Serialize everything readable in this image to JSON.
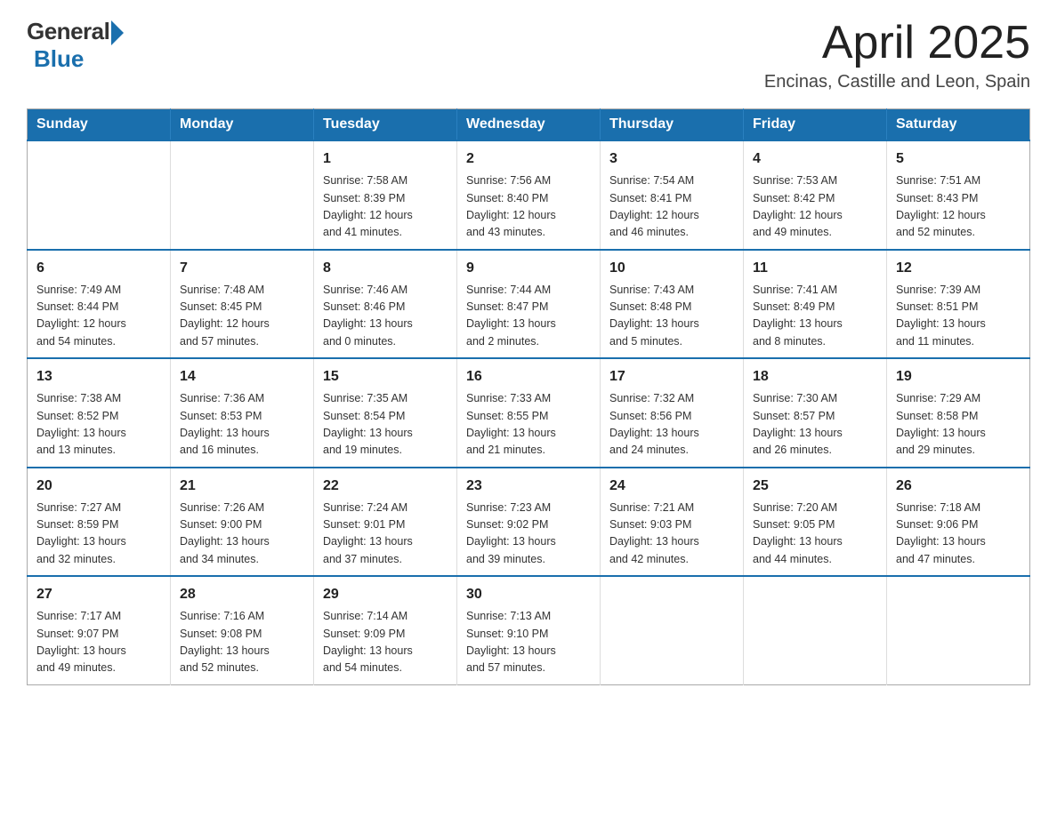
{
  "header": {
    "logo_general": "General",
    "logo_blue": "Blue",
    "month_title": "April 2025",
    "location": "Encinas, Castille and Leon, Spain"
  },
  "weekdays": [
    "Sunday",
    "Monday",
    "Tuesday",
    "Wednesday",
    "Thursday",
    "Friday",
    "Saturday"
  ],
  "weeks": [
    [
      {
        "day": "",
        "info": ""
      },
      {
        "day": "",
        "info": ""
      },
      {
        "day": "1",
        "info": "Sunrise: 7:58 AM\nSunset: 8:39 PM\nDaylight: 12 hours\nand 41 minutes."
      },
      {
        "day": "2",
        "info": "Sunrise: 7:56 AM\nSunset: 8:40 PM\nDaylight: 12 hours\nand 43 minutes."
      },
      {
        "day": "3",
        "info": "Sunrise: 7:54 AM\nSunset: 8:41 PM\nDaylight: 12 hours\nand 46 minutes."
      },
      {
        "day": "4",
        "info": "Sunrise: 7:53 AM\nSunset: 8:42 PM\nDaylight: 12 hours\nand 49 minutes."
      },
      {
        "day": "5",
        "info": "Sunrise: 7:51 AM\nSunset: 8:43 PM\nDaylight: 12 hours\nand 52 minutes."
      }
    ],
    [
      {
        "day": "6",
        "info": "Sunrise: 7:49 AM\nSunset: 8:44 PM\nDaylight: 12 hours\nand 54 minutes."
      },
      {
        "day": "7",
        "info": "Sunrise: 7:48 AM\nSunset: 8:45 PM\nDaylight: 12 hours\nand 57 minutes."
      },
      {
        "day": "8",
        "info": "Sunrise: 7:46 AM\nSunset: 8:46 PM\nDaylight: 13 hours\nand 0 minutes."
      },
      {
        "day": "9",
        "info": "Sunrise: 7:44 AM\nSunset: 8:47 PM\nDaylight: 13 hours\nand 2 minutes."
      },
      {
        "day": "10",
        "info": "Sunrise: 7:43 AM\nSunset: 8:48 PM\nDaylight: 13 hours\nand 5 minutes."
      },
      {
        "day": "11",
        "info": "Sunrise: 7:41 AM\nSunset: 8:49 PM\nDaylight: 13 hours\nand 8 minutes."
      },
      {
        "day": "12",
        "info": "Sunrise: 7:39 AM\nSunset: 8:51 PM\nDaylight: 13 hours\nand 11 minutes."
      }
    ],
    [
      {
        "day": "13",
        "info": "Sunrise: 7:38 AM\nSunset: 8:52 PM\nDaylight: 13 hours\nand 13 minutes."
      },
      {
        "day": "14",
        "info": "Sunrise: 7:36 AM\nSunset: 8:53 PM\nDaylight: 13 hours\nand 16 minutes."
      },
      {
        "day": "15",
        "info": "Sunrise: 7:35 AM\nSunset: 8:54 PM\nDaylight: 13 hours\nand 19 minutes."
      },
      {
        "day": "16",
        "info": "Sunrise: 7:33 AM\nSunset: 8:55 PM\nDaylight: 13 hours\nand 21 minutes."
      },
      {
        "day": "17",
        "info": "Sunrise: 7:32 AM\nSunset: 8:56 PM\nDaylight: 13 hours\nand 24 minutes."
      },
      {
        "day": "18",
        "info": "Sunrise: 7:30 AM\nSunset: 8:57 PM\nDaylight: 13 hours\nand 26 minutes."
      },
      {
        "day": "19",
        "info": "Sunrise: 7:29 AM\nSunset: 8:58 PM\nDaylight: 13 hours\nand 29 minutes."
      }
    ],
    [
      {
        "day": "20",
        "info": "Sunrise: 7:27 AM\nSunset: 8:59 PM\nDaylight: 13 hours\nand 32 minutes."
      },
      {
        "day": "21",
        "info": "Sunrise: 7:26 AM\nSunset: 9:00 PM\nDaylight: 13 hours\nand 34 minutes."
      },
      {
        "day": "22",
        "info": "Sunrise: 7:24 AM\nSunset: 9:01 PM\nDaylight: 13 hours\nand 37 minutes."
      },
      {
        "day": "23",
        "info": "Sunrise: 7:23 AM\nSunset: 9:02 PM\nDaylight: 13 hours\nand 39 minutes."
      },
      {
        "day": "24",
        "info": "Sunrise: 7:21 AM\nSunset: 9:03 PM\nDaylight: 13 hours\nand 42 minutes."
      },
      {
        "day": "25",
        "info": "Sunrise: 7:20 AM\nSunset: 9:05 PM\nDaylight: 13 hours\nand 44 minutes."
      },
      {
        "day": "26",
        "info": "Sunrise: 7:18 AM\nSunset: 9:06 PM\nDaylight: 13 hours\nand 47 minutes."
      }
    ],
    [
      {
        "day": "27",
        "info": "Sunrise: 7:17 AM\nSunset: 9:07 PM\nDaylight: 13 hours\nand 49 minutes."
      },
      {
        "day": "28",
        "info": "Sunrise: 7:16 AM\nSunset: 9:08 PM\nDaylight: 13 hours\nand 52 minutes."
      },
      {
        "day": "29",
        "info": "Sunrise: 7:14 AM\nSunset: 9:09 PM\nDaylight: 13 hours\nand 54 minutes."
      },
      {
        "day": "30",
        "info": "Sunrise: 7:13 AM\nSunset: 9:10 PM\nDaylight: 13 hours\nand 57 minutes."
      },
      {
        "day": "",
        "info": ""
      },
      {
        "day": "",
        "info": ""
      },
      {
        "day": "",
        "info": ""
      }
    ]
  ]
}
